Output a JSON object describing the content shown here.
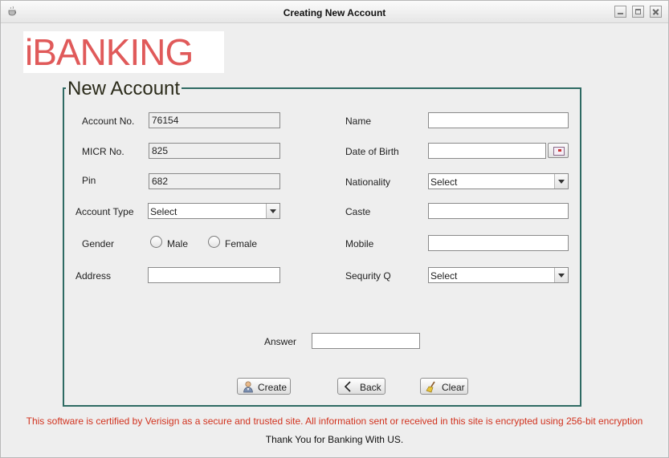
{
  "window": {
    "title": "Creating New Account",
    "icons": {
      "app": "coffee-cup-icon",
      "minimize": "minimize-icon",
      "maximize": "maximize-icon",
      "close": "close-icon"
    }
  },
  "logo": {
    "text": "iBANKING",
    "color": "#e05a5a"
  },
  "form": {
    "legend": "New Account",
    "border_color": "#2e6a63",
    "account_no": {
      "label": "Account No.",
      "value": "76154"
    },
    "micr_no": {
      "label": "MICR No.",
      "value": "825"
    },
    "pin": {
      "label": "Pin",
      "value": "682"
    },
    "account_type": {
      "label": "Account Type",
      "value": "Select"
    },
    "gender": {
      "label": "Gender",
      "options": [
        "Male",
        "Female"
      ]
    },
    "address": {
      "label": "Address",
      "value": ""
    },
    "name": {
      "label": "Name",
      "value": ""
    },
    "dob": {
      "label": "Date of Birth",
      "value": "",
      "icon": "calendar-icon"
    },
    "nationality": {
      "label": "Nationality",
      "value": "Select"
    },
    "caste": {
      "label": "Caste",
      "value": ""
    },
    "mobile": {
      "label": "Mobile",
      "value": ""
    },
    "security_q": {
      "label": "Sequrity Q",
      "value": "Select"
    },
    "answer": {
      "label": "Answer",
      "value": ""
    }
  },
  "buttons": {
    "create": {
      "label": "Create",
      "icon": "user-icon"
    },
    "back": {
      "label": "Back",
      "icon": "chevron-left-icon"
    },
    "clear": {
      "label": "Clear",
      "icon": "broom-icon"
    }
  },
  "footer": {
    "notice": "This software is certified by Verisign as a secure and trusted site. All information sent or received in this site is encrypted using 256-bit encryption",
    "notice_color": "#d1321e",
    "thanks": "Thank You for Banking With US."
  }
}
